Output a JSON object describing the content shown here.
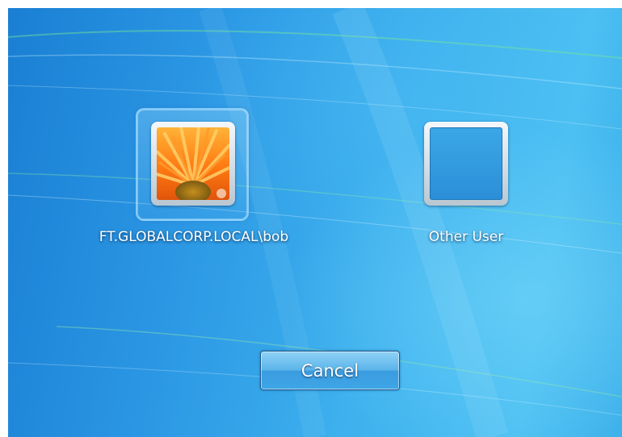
{
  "users": [
    {
      "name": "FT.GLOBALCORP.LOCAL\\bob",
      "selected": true,
      "picture": "orange-flower"
    },
    {
      "name": "Other User",
      "selected": false,
      "picture": "blank"
    }
  ],
  "actions": {
    "cancel_label": "Cancel"
  },
  "colors": {
    "background_start": "#1a7fd3",
    "background_end": "#4cc0f2",
    "label_text": "#ffffff"
  }
}
